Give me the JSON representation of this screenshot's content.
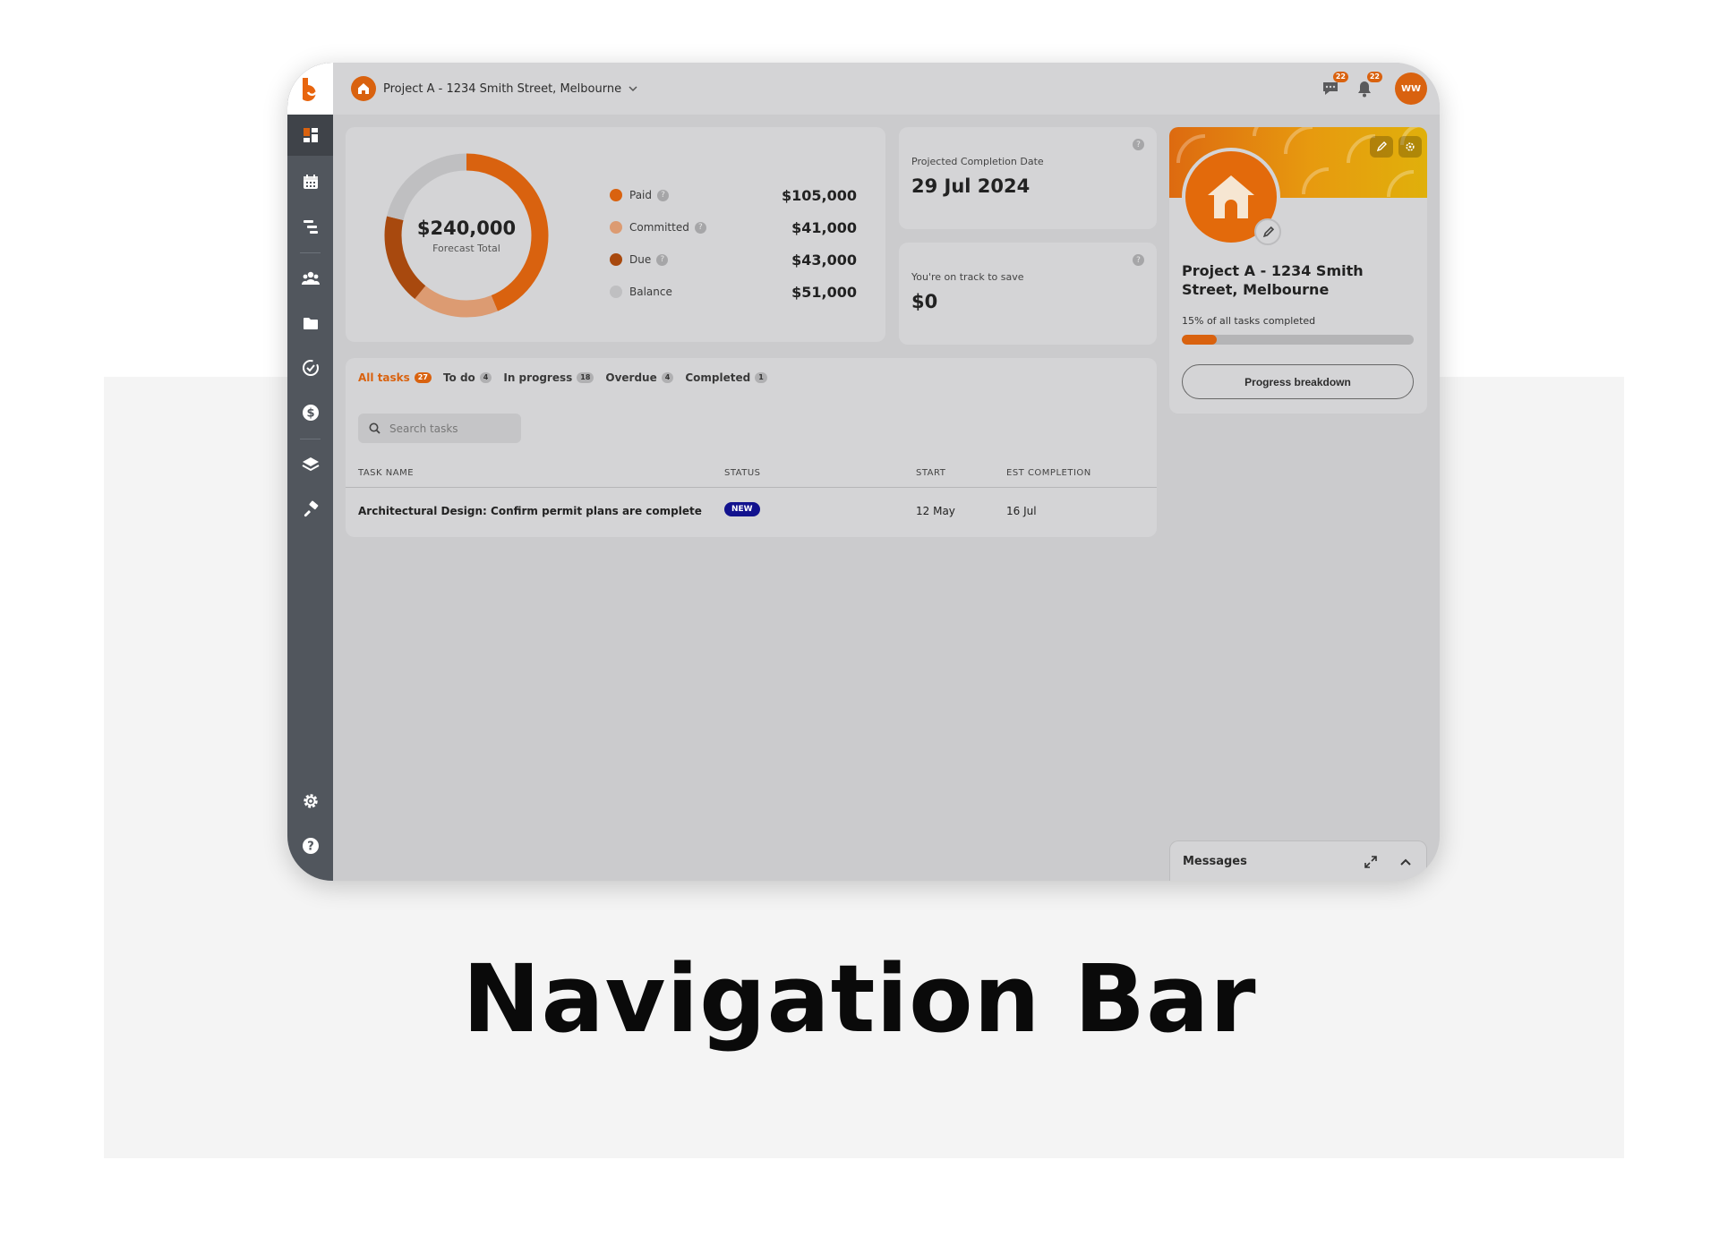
{
  "caption": "Navigation Bar",
  "colors": {
    "accent": "#d9620f",
    "sidebar": "#51565d",
    "new_badge": "#12128e"
  },
  "sidebar": {
    "logo": "builder-logo",
    "items": [
      {
        "icon": "dashboard-icon",
        "active": true
      },
      {
        "icon": "calendar-icon"
      },
      {
        "icon": "gantt-icon"
      },
      {
        "icon": "team-icon"
      },
      {
        "icon": "folder-icon"
      },
      {
        "icon": "tasks-check-icon"
      },
      {
        "icon": "dollar-icon"
      },
      {
        "icon": "layers-icon"
      },
      {
        "icon": "paint-brush-icon"
      }
    ],
    "bottom": [
      {
        "icon": "settings-icon"
      },
      {
        "icon": "help-icon"
      }
    ]
  },
  "topbar": {
    "project_selector": "Project A - 1234 Smith Street, Melbourne",
    "messages_count": "22",
    "notifications_count": "22",
    "avatar_initials": "WW"
  },
  "budget": {
    "total": "$240,000",
    "total_label": "Forecast Total",
    "chart_data": {
      "type": "pie",
      "categories": [
        "Paid",
        "Committed",
        "Due",
        "Balance"
      ],
      "values": [
        105000,
        41000,
        43000,
        51000
      ]
    },
    "legend": [
      {
        "name": "Paid",
        "value": "$105,000",
        "color": "#d9620f",
        "help": true
      },
      {
        "name": "Committed",
        "value": "$41,000",
        "color": "#dc9b72",
        "help": true
      },
      {
        "name": "Due",
        "value": "$43,000",
        "color": "#a8490e",
        "help": true
      },
      {
        "name": "Balance",
        "value": "$51,000",
        "color": "#bfbfc1",
        "help": false
      }
    ]
  },
  "completion": {
    "label": "Projected Completion Date",
    "value": "29 Jul 2024"
  },
  "savings": {
    "label": "You're on track to save",
    "value": "$0"
  },
  "project_card": {
    "name": "Project A - 1234 Smith Street, Melbourne",
    "progress_label": "15% of all tasks completed",
    "progress": 0.15,
    "button": "Progress breakdown"
  },
  "tasks": {
    "tabs": [
      {
        "label": "All tasks",
        "count": "27",
        "active": true
      },
      {
        "label": "To do",
        "count": "4"
      },
      {
        "label": "In progress",
        "count": "18"
      },
      {
        "label": "Overdue",
        "count": "4"
      },
      {
        "label": "Completed",
        "count": "1"
      }
    ],
    "search_placeholder": "Search tasks",
    "columns": [
      "TASK NAME",
      "STATUS",
      "START",
      "EST COMPLETION"
    ],
    "rows": [
      {
        "name": "Architectural Design: Confirm permit plans are complete",
        "status": "NEW",
        "start": "12 May",
        "completion": "16 Jul"
      }
    ]
  },
  "messages": {
    "title": "Messages"
  }
}
